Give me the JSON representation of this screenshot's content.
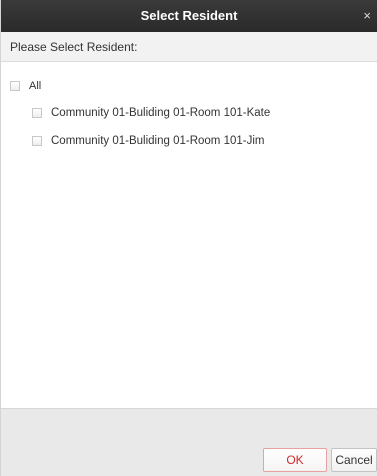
{
  "dialog": {
    "title": "Select Resident",
    "close_symbol": "×",
    "prompt": "Please Select Resident:"
  },
  "list": {
    "all_label": "All",
    "all_checked": false,
    "residents": [
      {
        "label": "Community 01-Buliding 01-Room 101-Kate",
        "checked": false
      },
      {
        "label": "Community 01-Buliding 01-Room 101-Jim",
        "checked": false
      }
    ]
  },
  "buttons": {
    "ok_label": "OK",
    "cancel_label": "Cancel"
  },
  "colors": {
    "titlebar": "#2f2f2f",
    "ok_text": "#d22a2a",
    "footer": "#e9e9e9"
  }
}
